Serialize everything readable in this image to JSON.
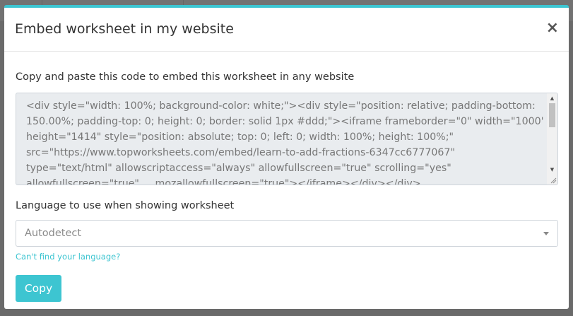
{
  "modal": {
    "title": "Embed worksheet in my website",
    "close_label": "×"
  },
  "body": {
    "intro_text": "Copy and paste this code to embed this worksheet in any website",
    "embed_code_lines": [
      "<div style=\"width: 100%; background-color: white;\"><div style=\"position: relative; padding-bottom:",
      "150.00%; padding-top: 0; height: 0; border: solid 1px #ddd;\"><iframe frameborder=\"0\" width=\"1000\"",
      "height=\"1414\" style=\"position: absolute; top: 0; left: 0; width: 100%; height: 100%;\"",
      "src=\"https://www.topworksheets.com/embed/learn-to-add-fractions-6347cc6777067\"",
      "type=\"text/html\" allowscriptaccess=\"always\" allowfullscreen=\"true\" scrolling=\"yes\"",
      "allowfullscreen=\"true\" ... mozallowfullscreen=\"true\"></iframe></div></div>"
    ],
    "language_label": "Language to use when showing worksheet",
    "language_value": "Autodetect",
    "help_link": "Can't find your language?",
    "copy_button": "Copy"
  },
  "colors": {
    "accent": "#3dc5d1",
    "overlay": "#6a6a6a",
    "code_bg": "#e9ecef"
  },
  "icons": {
    "close": "close-icon",
    "dropdown": "chevron-down-icon",
    "resize": "resize-grip-icon"
  }
}
